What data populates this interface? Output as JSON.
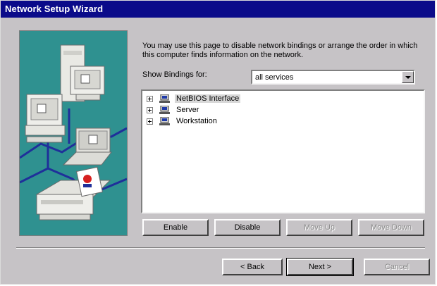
{
  "window": {
    "title": "Network Setup Wizard"
  },
  "description": "You may use this page to disable network bindings or arrange the order in which this computer finds information on the network.",
  "show_bindings": {
    "label": "Show Bindings for:",
    "selected": "all services"
  },
  "tree": [
    {
      "label": "NetBIOS Interface",
      "selected": true
    },
    {
      "label": "Server",
      "selected": false
    },
    {
      "label": "Workstation",
      "selected": false
    }
  ],
  "buttons": {
    "enable": "Enable",
    "disable": "Disable",
    "move_up": "Move Up",
    "move_down": "Move Down"
  },
  "nav": {
    "back": "< Back",
    "next": "Next >",
    "cancel": "Cancel"
  },
  "colors": {
    "titlebar": "#0b0b8a",
    "dialog": "#c6c3c6",
    "illustration_bg": "#2f9190"
  }
}
